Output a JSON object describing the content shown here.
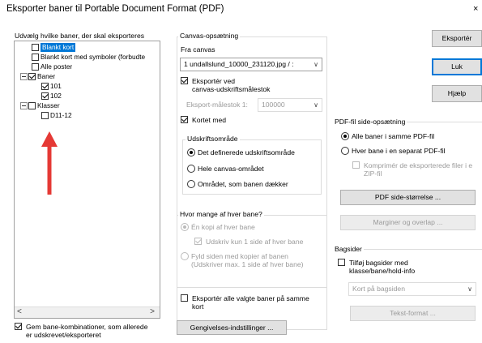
{
  "window": {
    "title": "Eksporter baner til Portable Document Format (PDF)",
    "close_glyph": "×"
  },
  "left_panel": {
    "label": "Udvælg hvilke baner, der skal eksporteres",
    "tree": [
      {
        "label": "Blankt kort",
        "checked": false,
        "selected": true
      },
      {
        "label": "Blankt kort med symboler (forbudte",
        "checked": false
      },
      {
        "label": "Alle poster",
        "checked": false
      },
      {
        "label": "Baner",
        "checked": true,
        "expander": true
      },
      {
        "label": "101",
        "checked": true
      },
      {
        "label": "102",
        "checked": true
      },
      {
        "label": "Klasser",
        "checked": false,
        "expander": true
      },
      {
        "label": "D11-12",
        "checked": false
      }
    ],
    "scroll_left": "<",
    "scroll_right": ">",
    "remember_combos": {
      "checked": true,
      "line1": "Gem bane-kombinationer, som allerede",
      "line2": "er udskrevet/eksporteret"
    }
  },
  "canvas_setup": {
    "title": "Canvas-opsætning",
    "from_canvas_label": "Fra canvas",
    "canvas_file": "1 undallslund_10000_231120.jpg  / :",
    "export_at_scale": {
      "checked": true,
      "line1": "Eksportér ved",
      "line2": "canvas-udskriftsmålestok"
    },
    "export_scale_label": "Eksport-målestok  1:",
    "export_scale_value": "100000",
    "map_with": {
      "checked": true,
      "label": "Kortet med"
    }
  },
  "print_area": {
    "title": "Udskriftsområde",
    "options": [
      {
        "label": "Det definerede udskriftsområde",
        "selected": true
      },
      {
        "label": "Hele canvas-området",
        "selected": false
      },
      {
        "label": "Området, som banen dækker",
        "selected": false
      }
    ]
  },
  "copies": {
    "title": "Hvor mange af hver bane?",
    "one_copy": "Én kopi af hver bane",
    "print_one_page": "Udskriv kun 1 side af hver bane",
    "fill_line1": "Fyld siden med kopier af banen",
    "fill_line2": "(Udskriver max. 1 side af hver bane)"
  },
  "export_all": {
    "checked": false,
    "line1": "Eksportér alle valgte baner på samme",
    "line2": "kort"
  },
  "appearance_button": "Gengivelses-indstillinger ...",
  "buttons": {
    "export": "Eksportér",
    "close": "Luk",
    "help": "Hjælp"
  },
  "pdf_page_setup": {
    "title": "PDF-fil side-opsætning",
    "all_in_same": "Alle baner i samme PDF-fil",
    "each_separate": "Hver bane i en separat PDF-fil",
    "compress_line1": "Komprimér de eksporterede filer i e",
    "compress_line2": "ZIP-fil",
    "page_size_button": "PDF side-størrelse ...",
    "margins_button": "Marginer og overlap ..."
  },
  "back_pages": {
    "title": "Bagsider",
    "add_line1": "Tilføj bagsider med",
    "add_line2": "klasse/bane/hold-info",
    "dropdown": "Kort på bagsiden",
    "text_format_button": "Tekst-format ..."
  },
  "colors": {
    "selection": "#0078d7",
    "arrow": "#e53935"
  }
}
